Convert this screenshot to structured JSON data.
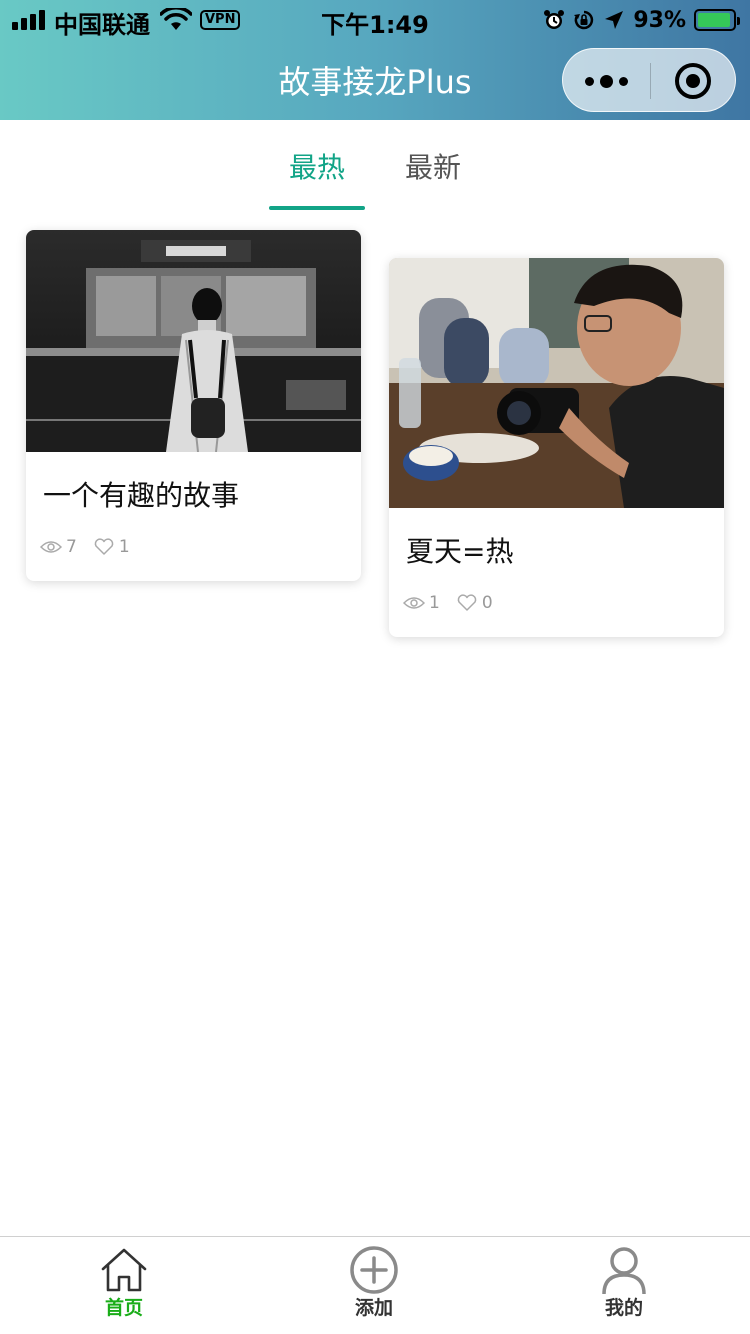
{
  "status_bar": {
    "carrier": "中国联通",
    "vpn": "VPN",
    "time": "下午1:49",
    "battery_percent": "93%",
    "battery_level": 0.93,
    "icons": [
      "signal-icon",
      "wifi-icon",
      "alarm-icon",
      "rotation-lock-icon",
      "location-icon",
      "battery-icon"
    ]
  },
  "header": {
    "title": "故事接龙Plus",
    "capsule_icons": [
      "more-icon",
      "close-target-icon"
    ]
  },
  "tabs": [
    {
      "label": "最热",
      "active": true
    },
    {
      "label": "最新",
      "active": false
    }
  ],
  "stories": [
    {
      "title": "一个有趣的故事",
      "views": "7",
      "likes": "1"
    },
    {
      "title": "夏天=热",
      "views": "1",
      "likes": "0"
    }
  ],
  "tabbar": [
    {
      "label": "首页",
      "icon": "home-icon",
      "active": true
    },
    {
      "label": "添加",
      "icon": "add-circle-icon",
      "active": false
    },
    {
      "label": "我的",
      "icon": "user-icon",
      "active": false
    }
  ],
  "colors": {
    "accent": "#12a487",
    "tabbar_active": "#1aad19",
    "header_start": "#69c9c5",
    "header_end": "#3f76a3"
  }
}
